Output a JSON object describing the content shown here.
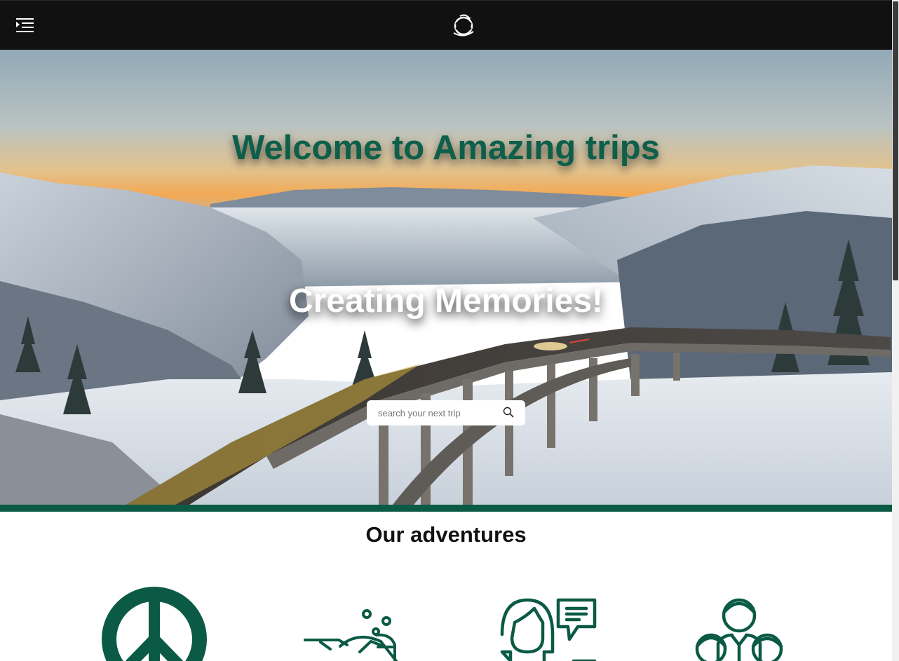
{
  "header": {
    "menu_icon": "menu-indent-icon",
    "logo_icon": "globe-logo-icon"
  },
  "hero": {
    "title": "Welcome to Amazing trips",
    "subtitle": "Creating Memories!",
    "search": {
      "placeholder": "search your next trip",
      "value": "",
      "icon": "search-icon"
    }
  },
  "colors": {
    "accent": "#0b5a45",
    "navbar": "#111111",
    "title": "#0d5f4a"
  },
  "adventures": {
    "title": "Our adventures",
    "items": [
      {
        "icon": "peace-sign-icon"
      },
      {
        "icon": "snorkel-diver-icon"
      },
      {
        "icon": "guide-chat-icon"
      },
      {
        "icon": "family-group-icon"
      }
    ]
  }
}
